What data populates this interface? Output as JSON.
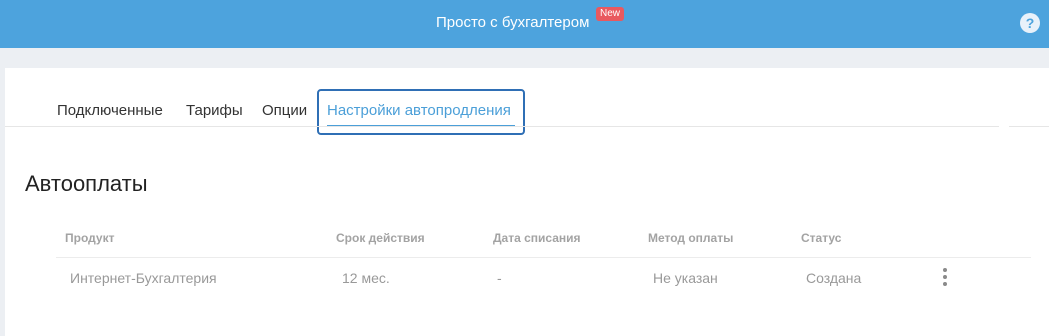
{
  "header": {
    "title": "Просто с бухгалтером",
    "badge": "New",
    "help_label": "?",
    "background_color": "#4da3dd"
  },
  "tabs": [
    {
      "label": "Подключенные",
      "active": false
    },
    {
      "label": "Тарифы",
      "active": false
    },
    {
      "label": "Опции",
      "active": false
    },
    {
      "label": "Настройки автопродления",
      "active": true
    }
  ],
  "page": {
    "title": "Автооплаты"
  },
  "table": {
    "columns": [
      "Продукт",
      "Срок действия",
      "Дата списания",
      "Метод оплаты",
      "Статус"
    ],
    "rows": [
      [
        "Интернет-Бухгалтерия",
        "12 мес.",
        "-",
        "Не указан",
        "Создана"
      ]
    ]
  },
  "icons": {
    "help": "question-circle-icon",
    "row_menu": "kebab-menu-icon"
  },
  "colors": {
    "accent": "#4b9fd8",
    "focus_border": "#2f6fb5",
    "badge": "#e9595f"
  }
}
